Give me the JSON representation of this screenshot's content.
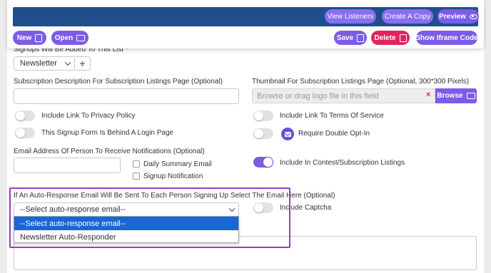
{
  "header": {
    "view_listeners": "View Listeners",
    "create_copy": "Create A Copy",
    "preview": "Preview",
    "new": "New",
    "open": "Open",
    "save": "Save",
    "delete": "Delete",
    "show_iframe": "Show Iframe Code"
  },
  "form": {
    "list_label": "Signups Will Be Added To This List *",
    "list_value": "Newsletter",
    "list_add": "+",
    "subscription_desc_label": "Subscription Description For Subscription Listings Page (Optional)",
    "subscription_desc_value": "",
    "thumbnail_label": "Thumbnail For Subscription Listings Page (Optional, 300*300 Pixels)",
    "thumbnail_placeholder": "Browse or drag logo file in this field",
    "thumbnail_clear": "×",
    "browse": "Browse",
    "toggles": {
      "privacy": {
        "label": "Include Link To Privacy Policy",
        "on": false
      },
      "terms": {
        "label": "Include Link To Terms Of Service",
        "on": false
      },
      "behind_login": {
        "label": "This Signup Form Is Behind A Login Page",
        "on": false
      },
      "double_optin": {
        "label": "Require Double Opt-In",
        "on": false
      },
      "contest_listings": {
        "label": "Include In Contest/Subscription Listings",
        "on": true
      },
      "captcha": {
        "label": "Include Captcha",
        "on": false
      }
    },
    "notify_label": "Email Address Of Person To Receive Notifications (Optional)",
    "notify_value": "",
    "daily_summary": "Daily Summary Email",
    "signup_notification": "Signup Notification",
    "autoresponse_label": "If An Auto-Response Email Will Be Sent To Each Person Signing Up Select The Email Here (Optional)",
    "autoresponse_value": "--Select auto-response email--",
    "autoresponse_options": [
      "--Select auto-response email--",
      "Newsletter Auto-Responder"
    ]
  },
  "colors": {
    "navbar": "#1e4f8c",
    "accent": "#7c5ce6",
    "danger": "#e0245e",
    "highlight": "#9c3db5",
    "option_selected": "#1a66d2"
  }
}
